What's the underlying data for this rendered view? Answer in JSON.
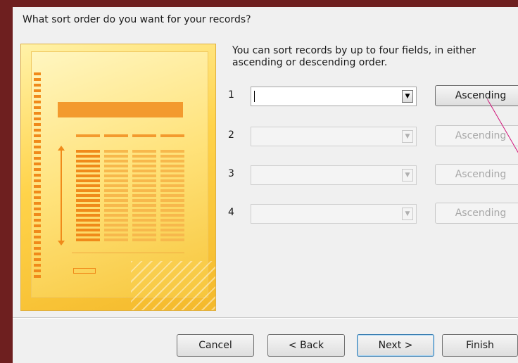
{
  "heading": "What sort order do you want for your records?",
  "description": "You can sort records by up to four fields, in either ascending or descending order.",
  "sort_rows": [
    {
      "number": "1",
      "field_value": "",
      "order_label": "Ascending",
      "enabled": true
    },
    {
      "number": "2",
      "field_value": "",
      "order_label": "Ascending",
      "enabled": false
    },
    {
      "number": "3",
      "field_value": "",
      "order_label": "Ascending",
      "enabled": false
    },
    {
      "number": "4",
      "field_value": "",
      "order_label": "Ascending",
      "enabled": false
    }
  ],
  "buttons": {
    "cancel": "Cancel",
    "back": "< Back",
    "next": "Next >",
    "finish": "Finish"
  },
  "icons": {
    "dropdown": "▼"
  },
  "colors": {
    "window_background": "#f0f0f0",
    "illustration": "#ffd34a",
    "accent": "#f39a2e"
  }
}
